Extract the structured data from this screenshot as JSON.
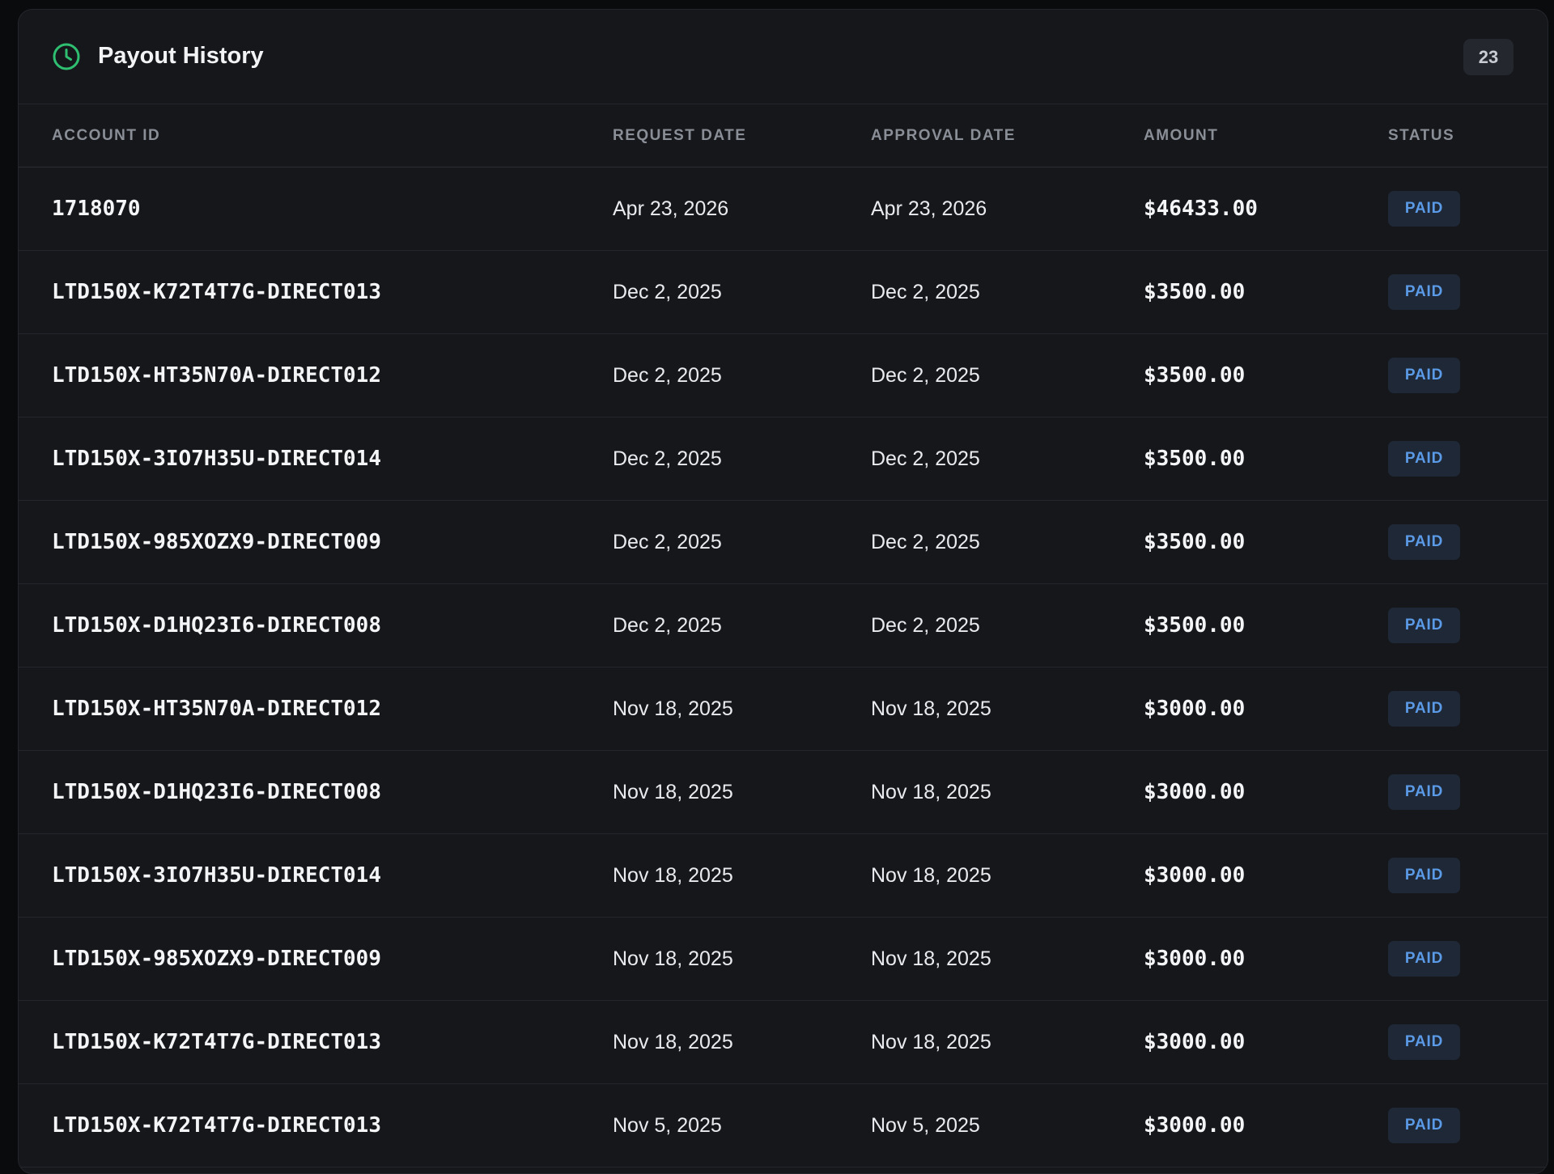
{
  "header": {
    "title": "Payout History",
    "count": "23",
    "icon": "clock-icon",
    "icon_color": "#2fbf71"
  },
  "columns": {
    "account_id": "ACCOUNT ID",
    "request_date": "REQUEST DATE",
    "approval_date": "APPROVAL DATE",
    "amount": "AMOUNT",
    "status": "STATUS"
  },
  "colors": {
    "background": "#15171b",
    "badge_bg": "#1f2836",
    "badge_text": "#5b9ae6"
  },
  "rows": [
    {
      "account_id": "1718070",
      "request_date": "Apr 23, 2026",
      "approval_date": "Apr 23, 2026",
      "amount": "$46433.00",
      "status": "PAID"
    },
    {
      "account_id": "LTD150X-K72T4T7G-DIRECT013",
      "request_date": "Dec 2, 2025",
      "approval_date": "Dec 2, 2025",
      "amount": "$3500.00",
      "status": "PAID"
    },
    {
      "account_id": "LTD150X-HT35N70A-DIRECT012",
      "request_date": "Dec 2, 2025",
      "approval_date": "Dec 2, 2025",
      "amount": "$3500.00",
      "status": "PAID"
    },
    {
      "account_id": "LTD150X-3IO7H35U-DIRECT014",
      "request_date": "Dec 2, 2025",
      "approval_date": "Dec 2, 2025",
      "amount": "$3500.00",
      "status": "PAID"
    },
    {
      "account_id": "LTD150X-985XOZX9-DIRECT009",
      "request_date": "Dec 2, 2025",
      "approval_date": "Dec 2, 2025",
      "amount": "$3500.00",
      "status": "PAID"
    },
    {
      "account_id": "LTD150X-D1HQ23I6-DIRECT008",
      "request_date": "Dec 2, 2025",
      "approval_date": "Dec 2, 2025",
      "amount": "$3500.00",
      "status": "PAID"
    },
    {
      "account_id": "LTD150X-HT35N70A-DIRECT012",
      "request_date": "Nov 18, 2025",
      "approval_date": "Nov 18, 2025",
      "amount": "$3000.00",
      "status": "PAID"
    },
    {
      "account_id": "LTD150X-D1HQ23I6-DIRECT008",
      "request_date": "Nov 18, 2025",
      "approval_date": "Nov 18, 2025",
      "amount": "$3000.00",
      "status": "PAID"
    },
    {
      "account_id": "LTD150X-3IO7H35U-DIRECT014",
      "request_date": "Nov 18, 2025",
      "approval_date": "Nov 18, 2025",
      "amount": "$3000.00",
      "status": "PAID"
    },
    {
      "account_id": "LTD150X-985XOZX9-DIRECT009",
      "request_date": "Nov 18, 2025",
      "approval_date": "Nov 18, 2025",
      "amount": "$3000.00",
      "status": "PAID"
    },
    {
      "account_id": "LTD150X-K72T4T7G-DIRECT013",
      "request_date": "Nov 18, 2025",
      "approval_date": "Nov 18, 2025",
      "amount": "$3000.00",
      "status": "PAID"
    },
    {
      "account_id": "LTD150X-K72T4T7G-DIRECT013",
      "request_date": "Nov 5, 2025",
      "approval_date": "Nov 5, 2025",
      "amount": "$3000.00",
      "status": "PAID"
    }
  ]
}
